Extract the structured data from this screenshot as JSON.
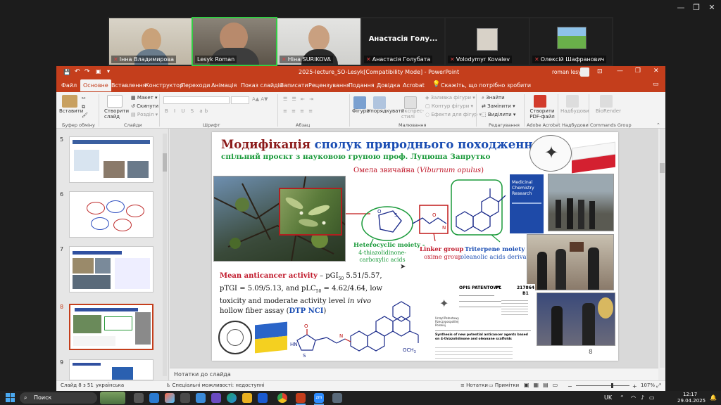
{
  "zoom": {
    "participants": [
      {
        "name": "Інна Владимирова"
      },
      {
        "name": "Lesyk Roman"
      },
      {
        "name": "Ніна SURIKOVA"
      },
      {
        "name": "Анастасія Голубата",
        "title": "Анастасія Голу..."
      },
      {
        "name": "Volodymyr Kovalev"
      },
      {
        "name": "Олексій Шафранович"
      }
    ]
  },
  "ppt": {
    "title": "2025-lecture_SO-Lesyk[Compatibility Mode]  -  PowerPoint",
    "user": "roman lesyk",
    "tabs": [
      "Файл",
      "Основне",
      "Вставлення",
      "Конструктор",
      "Переходи",
      "Анімація",
      "Показ слайдів",
      "Записати",
      "Рецензування",
      "Подання",
      "Довідка",
      "Acrobat"
    ],
    "active_tab": "Основне",
    "search": "Скажіть, що потрібно зробити",
    "ribbon": {
      "paste": "Вставити",
      "new_slide": "Створити слайд",
      "layout": "Макет",
      "reset": "Скинути",
      "section": "Розділ",
      "shape_fill": "Заливка фігури",
      "shape_outline": "Контур фігури",
      "shape_effects": "Ефекти для фігур",
      "shapes": "Фігури",
      "arrange": "Упорядкувати",
      "quick_styles": "Експрес-стилі",
      "find": "Знайти",
      "replace": "Замінити",
      "select": "Виділити",
      "create_pdf": "Створити PDF-файл",
      "send": "Надбудови",
      "biorender": "BioRender",
      "groups": {
        "clipboard": "Буфер обміну",
        "slides": "Слайди",
        "font": "Шрифт",
        "paragraph": "Абзац",
        "drawing": "Малювання",
        "editing": "Редагування",
        "acrobat": "Adobe Acrobat",
        "addins": "Надбудови",
        "commands": "Commands Group"
      }
    },
    "thumbnails": [
      "5",
      "6",
      "7",
      "8",
      "9"
    ],
    "selected_slide": "8",
    "notes_placeholder": "Нотатки до слайда",
    "status": {
      "slide_count": "Слайд 8 з 51",
      "language": "українська",
      "accessibility": "Спеціальні можливості: недоступні",
      "notes": "Нотатки",
      "comments": "Примітки",
      "zoom": "107%"
    }
  },
  "slide": {
    "title_part1": "Модифікація ",
    "title_part2": "сполук природнього походження",
    "subtitle": "спільний проєкт з науковою групою проф. Луцюша Запрутко",
    "plant_prefix": "Омела звичайна (",
    "plant_latin": "Viburnum opulus",
    "plant_suffix": ")",
    "journal_title": "Medicinal Chemistry Research",
    "labels": {
      "hetero_title": "Heterocyclic moiety -",
      "hetero_sub": "4-thiazolidinone-carboxylic acids",
      "linker_title": "Linker group",
      "linker_sub": "oxime group",
      "triterpene_title": "Triterpene moiety",
      "triterpene_sub": "oleanolic acids derivatives"
    },
    "activity": {
      "lead": "Mean anticancer activity",
      "line1": " – pGI",
      "sub50a": "50",
      "v1": " 5.51/5.57,",
      "line2a": "pTGI = 5.09/5.13, and pLC",
      "sub50b": "50",
      "line2b": " = 4.62/4.64, low",
      "line3": "toxicity and moderate activity level ",
      "invivo": "in vivo",
      "line4": "hollow fiber assay (",
      "dtp": "DTP NCI",
      "line4end": ")"
    },
    "patent": {
      "header": "OPIS PATENTOWY",
      "country": "PL",
      "number": "217864",
      "kind": "B1",
      "office": "Urząd Patentowy Rzeczypospolitej Polskiej",
      "title": "Synthesis of new potential anticancer agents based on 4-thiazolidinone and oleanane scaffolds"
    },
    "page_number": "8",
    "atoms": {
      "o": "O",
      "s": "S",
      "n": "N",
      "hn": "HN",
      "och3": "OCH",
      "three": "3",
      "x": "X"
    }
  },
  "taskbar": {
    "search": "Поиск",
    "lang": "UK",
    "time": "12:17",
    "date": "29.04.2025"
  },
  "colors": {
    "ppt_accent": "#c43e1c",
    "title_red": "#8b1a1a",
    "title_blue": "#1a4db3",
    "green": "#1a9a3a",
    "red": "#c0182a",
    "navy": "#1a2a8a"
  }
}
